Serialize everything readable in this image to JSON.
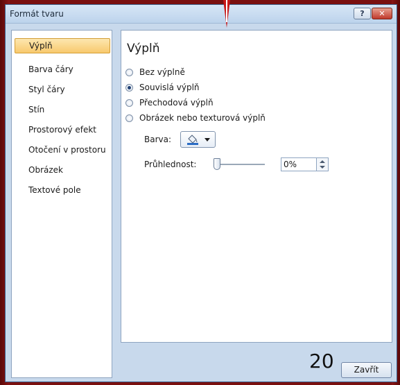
{
  "window": {
    "title": "Formát tvaru",
    "help_label": "?",
    "close_label": "✕"
  },
  "sidebar": {
    "items": [
      {
        "label": "Výplň"
      },
      {
        "label": "Barva čáry"
      },
      {
        "label": "Styl čáry"
      },
      {
        "label": "Stín"
      },
      {
        "label": "Prostorový efekt"
      },
      {
        "label": "Otočení v prostoru"
      },
      {
        "label": "Obrázek"
      },
      {
        "label": "Textové pole"
      }
    ],
    "selected_index": 0
  },
  "fill": {
    "section_title": "Výplň",
    "options": [
      {
        "label": "Bez výplně",
        "checked": false
      },
      {
        "label": "Souvislá výplň",
        "checked": true
      },
      {
        "label": "Přechodová výplň",
        "checked": false
      },
      {
        "label": "Obrázek nebo texturová výplň",
        "checked": false
      }
    ],
    "color_label": "Barva:",
    "color_swatch": "#2b6cc4",
    "transparency_label": "Průhlednost:",
    "transparency_value": "0%"
  },
  "footer": {
    "slide_number": "20",
    "close_button": "Zavřít"
  },
  "colors": {
    "background": "#7a1010",
    "pointer": "#c81818",
    "selected_item": "#f8c96d"
  }
}
